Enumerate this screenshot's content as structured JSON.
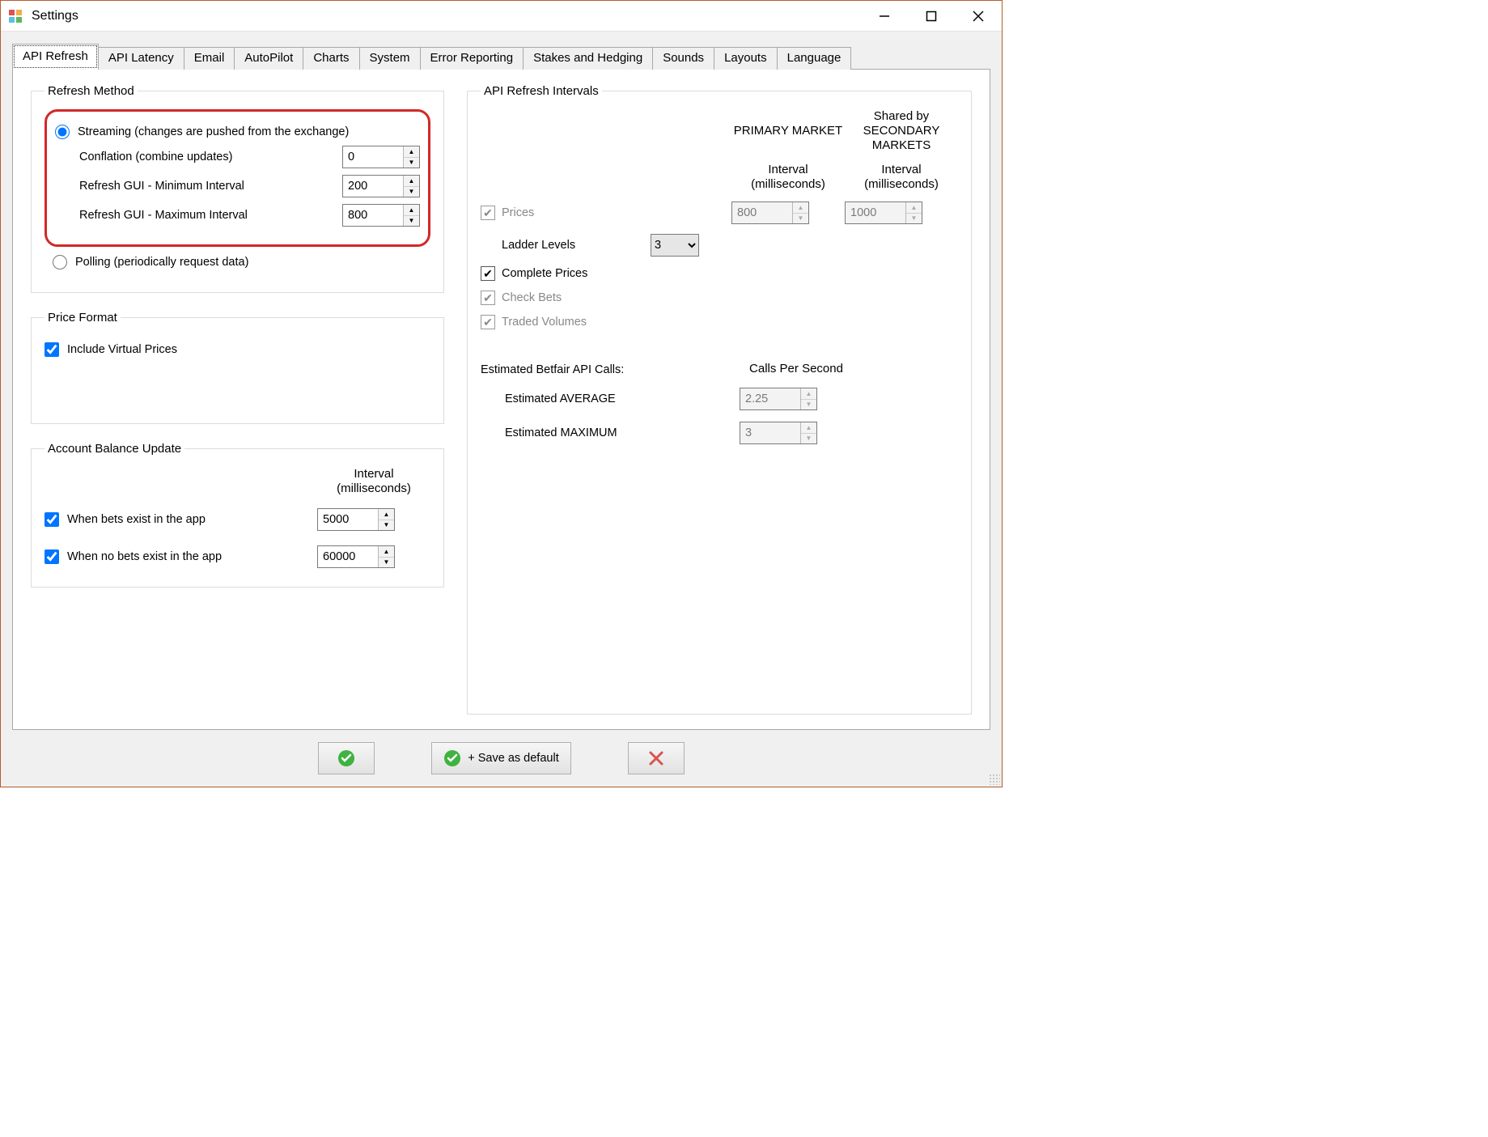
{
  "window": {
    "title": "Settings"
  },
  "tabs": [
    "API Refresh",
    "API Latency",
    "Email",
    "AutoPilot",
    "Charts",
    "System",
    "Error Reporting",
    "Stakes and Hedging",
    "Sounds",
    "Layouts",
    "Language"
  ],
  "active_tab": 0,
  "refresh_method": {
    "legend": "Refresh Method",
    "streaming_label": "Streaming (changes are pushed from the exchange)",
    "streaming_selected": true,
    "conflation_label": "Conflation (combine updates)",
    "conflation_value": "0",
    "gui_min_label": "Refresh GUI - Minimum Interval",
    "gui_min_value": "200",
    "gui_max_label": "Refresh GUI - Maximum Interval",
    "gui_max_value": "800",
    "polling_label": "Polling (periodically request data)",
    "polling_selected": false
  },
  "price_format": {
    "legend": "Price Format",
    "include_virtual_label": "Include Virtual Prices",
    "include_virtual_checked": true
  },
  "account_balance": {
    "legend": "Account Balance Update",
    "interval_header": "Interval (milliseconds)",
    "bets_exist_label": "When bets exist in the app",
    "bets_exist_checked": true,
    "bets_exist_value": "5000",
    "no_bets_label": "When no bets exist in the app",
    "no_bets_checked": true,
    "no_bets_value": "60000"
  },
  "api_intervals": {
    "legend": "API Refresh Intervals",
    "primary_header": "PRIMARY MARKET",
    "secondary_header": "Shared by SECONDARY MARKETS",
    "interval_sub": "Interval (milliseconds)",
    "prices_label": "Prices",
    "prices_primary": "800",
    "prices_secondary": "1000",
    "ladder_label": "Ladder Levels",
    "ladder_value": "3",
    "complete_label": "Complete Prices",
    "complete_checked": true,
    "checkbets_label": "Check Bets",
    "traded_label": "Traded Volumes",
    "est_header": "Estimated Betfair API Calls:",
    "est_cps_header": "Calls Per Second",
    "est_avg_label": "Estimated AVERAGE",
    "est_avg_value": "2.25",
    "est_max_label": "Estimated MAXIMUM",
    "est_max_value": "3"
  },
  "footer": {
    "save_default_label": "+ Save as default"
  }
}
